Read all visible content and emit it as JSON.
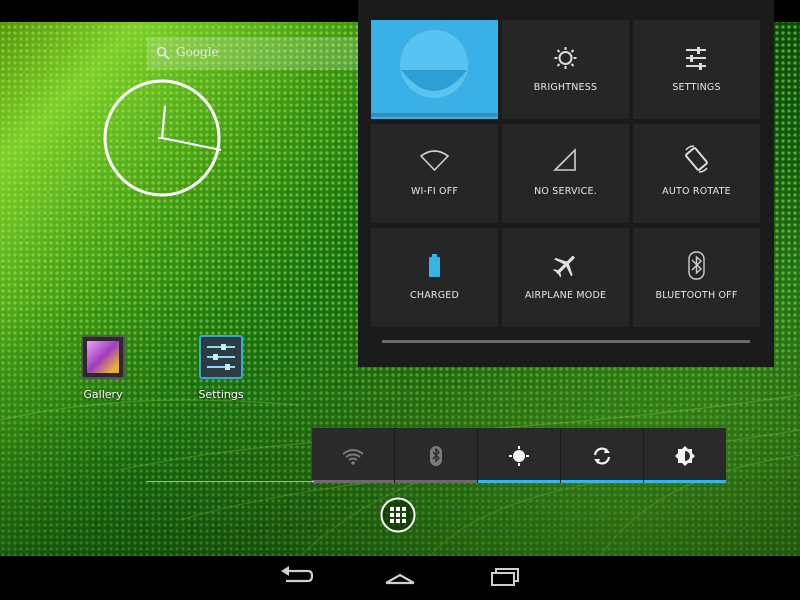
{
  "search": {
    "placeholder": "Google",
    "icon": "search-icon"
  },
  "clock": {
    "time": "12:14"
  },
  "apps": [
    {
      "label": "Gallery",
      "icon": "gallery-icon"
    },
    {
      "label": "Settings",
      "icon": "settings-icon"
    }
  ],
  "quick_settings": {
    "user": {
      "label": "",
      "icon": "user-avatar-icon",
      "color": "#3bb0e6"
    },
    "brightness": {
      "label": "BRIGHTNESS",
      "icon": "brightness-icon"
    },
    "settings": {
      "label": "SETTINGS",
      "icon": "settings-sliders-icon"
    },
    "wifi": {
      "label": "WI-FI OFF",
      "icon": "wifi-icon"
    },
    "signal": {
      "label": "NO SERVICE.",
      "icon": "signal-icon"
    },
    "rotate": {
      "label": "AUTO ROTATE",
      "icon": "rotate-icon"
    },
    "battery": {
      "label": "CHARGED",
      "icon": "battery-icon",
      "color": "#34b5e5"
    },
    "airplane": {
      "label": "AIRPLANE MODE",
      "icon": "airplane-icon"
    },
    "bluetooth": {
      "label": "BLUETOOTH OFF",
      "icon": "bluetooth-icon"
    }
  },
  "power_control": [
    {
      "icon": "wifi-icon",
      "on": false
    },
    {
      "icon": "bluetooth-icon",
      "on": false
    },
    {
      "icon": "location-icon",
      "on": true
    },
    {
      "icon": "sync-icon",
      "on": true
    },
    {
      "icon": "brightness-icon",
      "on": true
    }
  ],
  "accent_color": "#34b5e5",
  "nav": [
    "back-icon",
    "home-icon",
    "recent-apps-icon"
  ]
}
